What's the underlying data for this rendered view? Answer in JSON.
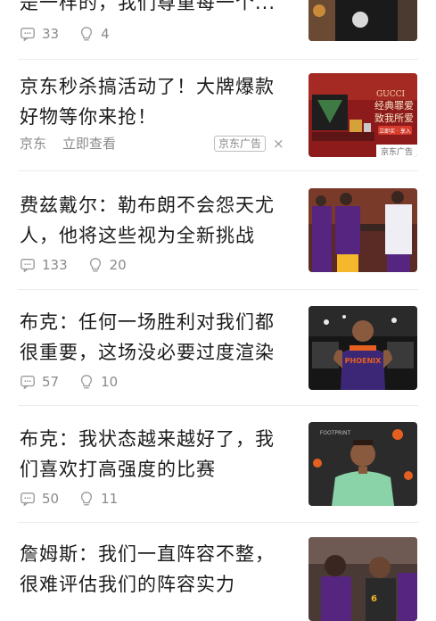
{
  "feed": {
    "items": [
      {
        "title": "是一样的，我们尊重每一个...",
        "comments": "33",
        "likes": "4"
      },
      {
        "title": "京东秒杀搞活动了！大牌爆款好物等你来抢！",
        "source": "京东",
        "cta": "立即查看",
        "badge": "京东广告",
        "close": "×",
        "thumb_text": {
          "brand": "GUCCI",
          "line1": "经典罪爱",
          "line2": "致我所爱",
          "btn": "立即买 · 享入",
          "tag": "京东广告"
        }
      },
      {
        "title": "费兹戴尔：勒布朗不会怨天尤人，他将这些视为全新挑战",
        "comments": "133",
        "likes": "20"
      },
      {
        "title": "布克：任何一场胜利对我们都很重要，这场没必要过度渲染",
        "comments": "57",
        "likes": "10",
        "thumb_text": {
          "jersey": "PHOENIX"
        }
      },
      {
        "title": "布克：我状态越来越好了，我们喜欢打高强度的比赛",
        "comments": "50",
        "likes": "11",
        "thumb_text": {
          "sponsor": "FOOTPRINT"
        }
      },
      {
        "title": "詹姆斯：我们一直阵容不整，很难评估我们的阵容实力"
      }
    ]
  },
  "colors": {
    "text": "#1c1c1c",
    "meta": "#8a8a8a",
    "divider": "#ececec",
    "lakers_purple": "#55257f",
    "lakers_gold": "#f5b82c",
    "suns_purple": "#3c2776"
  }
}
